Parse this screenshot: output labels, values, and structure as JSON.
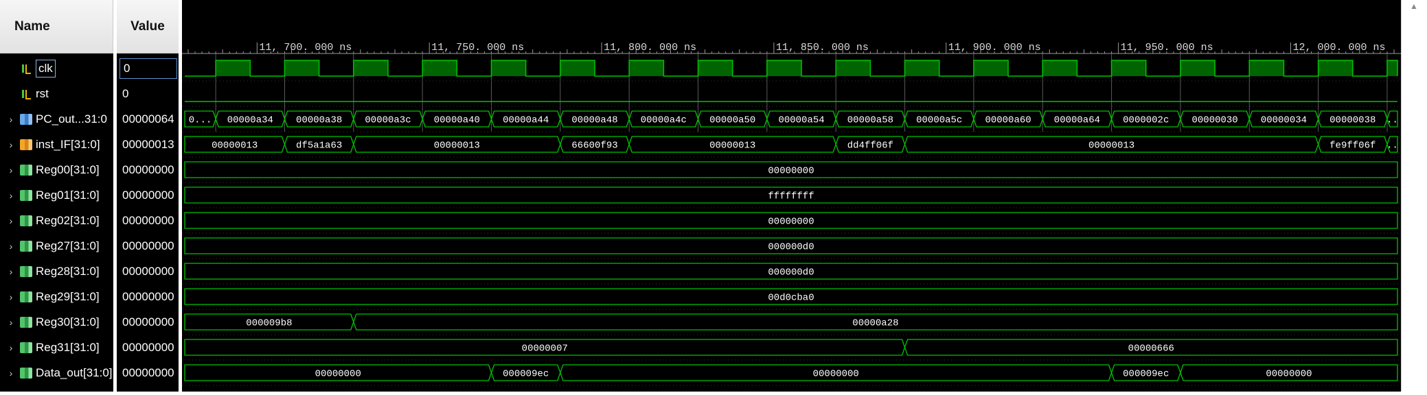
{
  "columns": {
    "name": "Name",
    "value": "Value"
  },
  "signals": [
    {
      "name": "clk",
      "value": "0",
      "kind": "input",
      "expandable": false
    },
    {
      "name": "rst",
      "value": "0",
      "kind": "input",
      "expandable": false
    },
    {
      "name": "PC_out...31:0",
      "value": "00000064",
      "kind": "bus-blue",
      "expandable": true
    },
    {
      "name": "inst_IF[31:0]",
      "value": "00000013",
      "kind": "bus-orange",
      "expandable": true
    },
    {
      "name": "Reg00[31:0]",
      "value": "00000000",
      "kind": "bus-green",
      "expandable": true
    },
    {
      "name": "Reg01[31:0]",
      "value": "00000000",
      "kind": "bus-green",
      "expandable": true
    },
    {
      "name": "Reg02[31:0]",
      "value": "00000000",
      "kind": "bus-green",
      "expandable": true
    },
    {
      "name": "Reg27[31:0]",
      "value": "00000000",
      "kind": "bus-green",
      "expandable": true
    },
    {
      "name": "Reg28[31:0]",
      "value": "00000000",
      "kind": "bus-green",
      "expandable": true
    },
    {
      "name": "Reg29[31:0]",
      "value": "00000000",
      "kind": "bus-green",
      "expandable": true
    },
    {
      "name": "Reg30[31:0]",
      "value": "00000000",
      "kind": "bus-green",
      "expandable": true
    },
    {
      "name": "Reg31[31:0]",
      "value": "00000000",
      "kind": "bus-green",
      "expandable": true
    },
    {
      "name": "Data_out[31:0]",
      "value": "00000000",
      "kind": "bus-green",
      "expandable": true
    }
  ],
  "timeline": {
    "unit": "ns",
    "start": 11679,
    "end": 12031,
    "labels": [
      {
        "t": 11700,
        "text": "11, 700. 000 ns"
      },
      {
        "t": 11750,
        "text": "11, 750. 000 ns"
      },
      {
        "t": 11800,
        "text": "11, 800. 000 ns"
      },
      {
        "t": 11850,
        "text": "11, 850. 000 ns"
      },
      {
        "t": 11900,
        "text": "11, 900. 000 ns"
      },
      {
        "t": 11950,
        "text": "11, 950. 000 ns"
      },
      {
        "t": 12000,
        "text": "12, 000. 000 ns"
      }
    ]
  },
  "clock": {
    "first_rise": 11688,
    "period": 20,
    "duty": 0.5
  },
  "waves": [
    {
      "signal": "clk",
      "type": "clock"
    },
    {
      "signal": "rst",
      "type": "low"
    },
    {
      "signal": "PC_out...31:0",
      "type": "bus",
      "segments": [
        {
          "end": 11688,
          "text": "0..."
        },
        {
          "end": 11708,
          "text": "00000a34"
        },
        {
          "end": 11728,
          "text": "00000a38"
        },
        {
          "end": 11748,
          "text": "00000a3c"
        },
        {
          "end": 11768,
          "text": "00000a40"
        },
        {
          "end": 11788,
          "text": "00000a44"
        },
        {
          "end": 11808,
          "text": "00000a48"
        },
        {
          "end": 11828,
          "text": "00000a4c"
        },
        {
          "end": 11848,
          "text": "00000a50"
        },
        {
          "end": 11868,
          "text": "00000a54"
        },
        {
          "end": 11888,
          "text": "00000a58"
        },
        {
          "end": 11908,
          "text": "00000a5c"
        },
        {
          "end": 11928,
          "text": "00000a60"
        },
        {
          "end": 11948,
          "text": "00000a64"
        },
        {
          "end": 11968,
          "text": "0000002c"
        },
        {
          "end": 11988,
          "text": "00000030"
        },
        {
          "end": 12008,
          "text": "00000034"
        },
        {
          "end": 12028,
          "text": "00000038"
        },
        {
          "end": 12031,
          "text": ".."
        }
      ]
    },
    {
      "signal": "inst_IF[31:0]",
      "type": "bus",
      "segments": [
        {
          "end": 11708,
          "text": "00000013"
        },
        {
          "end": 11728,
          "text": "df5a1a63"
        },
        {
          "end": 11788,
          "text": "00000013"
        },
        {
          "end": 11808,
          "text": "66600f93"
        },
        {
          "end": 11868,
          "text": "00000013"
        },
        {
          "end": 11888,
          "text": "dd4ff06f"
        },
        {
          "end": 12008,
          "text": "00000013"
        },
        {
          "end": 12028,
          "text": "fe9ff06f"
        },
        {
          "end": 12031,
          "text": ".."
        }
      ]
    },
    {
      "signal": "Reg00[31:0]",
      "type": "bus",
      "segments": [
        {
          "end": 12031,
          "text": "00000000"
        }
      ]
    },
    {
      "signal": "Reg01[31:0]",
      "type": "bus",
      "segments": [
        {
          "end": 12031,
          "text": "ffffffff"
        }
      ]
    },
    {
      "signal": "Reg02[31:0]",
      "type": "bus",
      "segments": [
        {
          "end": 12031,
          "text": "00000000"
        }
      ]
    },
    {
      "signal": "Reg27[31:0]",
      "type": "bus",
      "segments": [
        {
          "end": 12031,
          "text": "000000d0"
        }
      ]
    },
    {
      "signal": "Reg28[31:0]",
      "type": "bus",
      "segments": [
        {
          "end": 12031,
          "text": "000000d0"
        }
      ]
    },
    {
      "signal": "Reg29[31:0]",
      "type": "bus",
      "segments": [
        {
          "end": 12031,
          "text": "00d0cba0"
        }
      ]
    },
    {
      "signal": "Reg30[31:0]",
      "type": "bus",
      "segments": [
        {
          "end": 11728,
          "text": "000009b8"
        },
        {
          "end": 12031,
          "text": "00000a28"
        }
      ]
    },
    {
      "signal": "Reg31[31:0]",
      "type": "bus",
      "segments": [
        {
          "end": 11888,
          "text": "00000007"
        },
        {
          "end": 12031,
          "text": "00000666"
        }
      ]
    },
    {
      "signal": "Data_out[31:0]",
      "type": "bus",
      "segments": [
        {
          "end": 11768,
          "text": "00000000"
        },
        {
          "end": 11788,
          "text": "000009ec"
        },
        {
          "end": 11948,
          "text": "00000000"
        },
        {
          "end": 11968,
          "text": "000009ec"
        },
        {
          "end": 12031,
          "text": "00000000"
        }
      ]
    }
  ],
  "colors": {
    "wave": "#00c400",
    "clock_fill": "#006400",
    "background": "#000000",
    "text": "#ffffff",
    "cursor": "#5a5a5a"
  }
}
